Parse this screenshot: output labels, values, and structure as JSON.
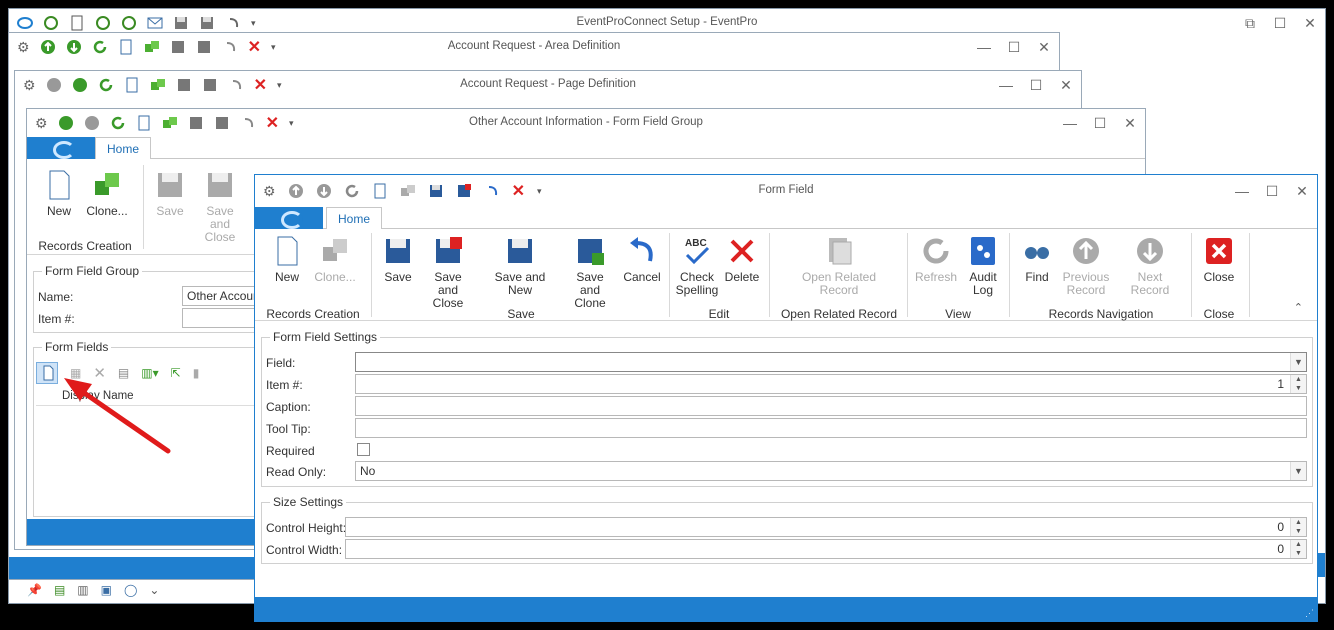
{
  "main_window": {
    "title": "EventProConnect Setup - EventPro"
  },
  "win_area": {
    "title": "Account Request - Area Definition"
  },
  "win_page": {
    "title": "Account Request - Page Definition"
  },
  "win_group": {
    "title": "Other Account Information - Form Field Group",
    "tab_home": "Home",
    "new": "New",
    "clone": "Clone...",
    "save": "Save",
    "save_close": "Save and Close",
    "grp_records_creation": "Records Creation",
    "fs_group": "Form Field Group",
    "name_label": "Name:",
    "name_value": "Other Account",
    "item_label": "Item #:",
    "fs_fields": "Form Fields",
    "col_display_name": "Display Name"
  },
  "form_field": {
    "title": "Form Field",
    "tab_home": "Home",
    "ribbon": {
      "new": "New",
      "clone": "Clone...",
      "save": "Save",
      "save_close": "Save and Close",
      "save_new": "Save and New",
      "save_clone": "Save and Clone",
      "cancel": "Cancel",
      "check_spelling": "Check Spelling",
      "delete": "Delete",
      "open_related": "Open Related Record",
      "refresh": "Refresh",
      "audit_log": "Audit Log",
      "find": "Find",
      "prev_record": "Previous Record",
      "next_record": "Next Record",
      "close": "Close",
      "grp_records_creation": "Records Creation",
      "grp_save": "Save",
      "grp_edit": "Edit",
      "grp_open_related": "Open Related Record",
      "grp_view": "View",
      "grp_nav": "Records Navigation",
      "grp_close": "Close"
    },
    "settings": {
      "legend": "Form Field Settings",
      "field_label": "Field:",
      "field_value": "",
      "item_label": "Item #:",
      "item_value": "1",
      "caption_label": "Caption:",
      "caption_value": "",
      "tooltip_label": "Tool Tip:",
      "tooltip_value": "",
      "required_label": "Required",
      "readonly_label": "Read Only:",
      "readonly_value": "No"
    },
    "size": {
      "legend": "Size Settings",
      "height_label": "Control Height:",
      "height_value": "0",
      "width_label": "Control Width:",
      "width_value": "0"
    }
  },
  "colors": {
    "accent": "#1f7fcf",
    "annotation_arrow": "#e01b1b"
  }
}
